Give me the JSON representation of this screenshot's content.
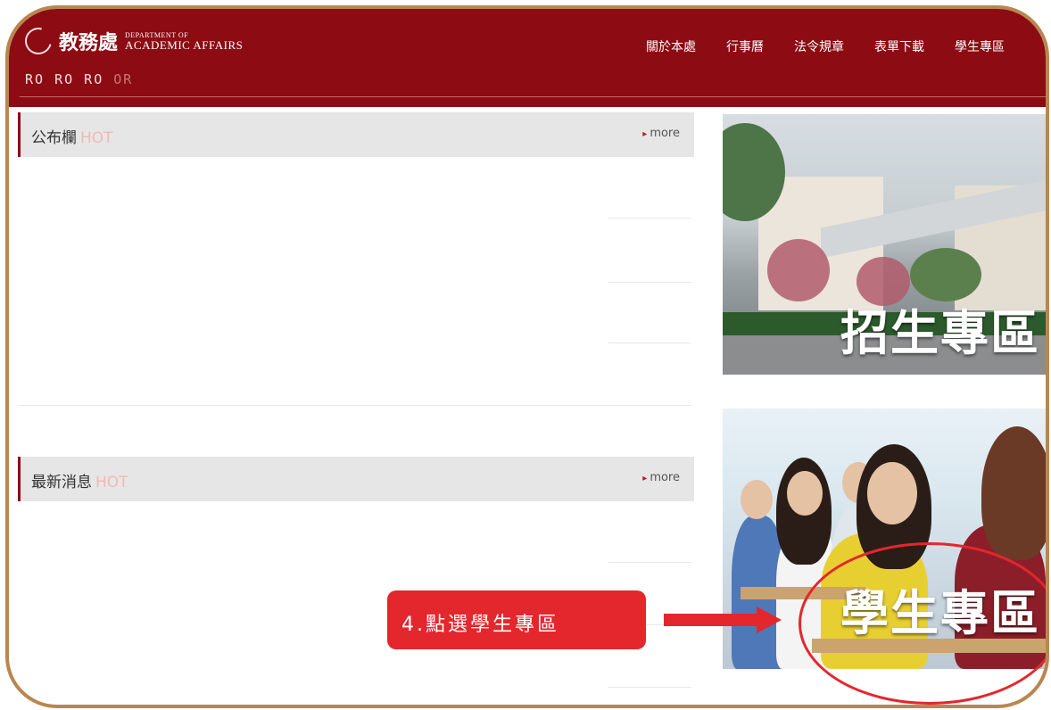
{
  "header": {
    "logo_cn": "教務處",
    "logo_en_top": "DEPARTMENT OF",
    "logo_en_bottom": "ACADEMIC AFFAIRS",
    "logo_script": "RO RO RO",
    "logo_script_faint": "OR"
  },
  "nav": {
    "items": [
      "關於本處",
      "行事曆",
      "法令規章",
      "表單下載",
      "學生專區"
    ]
  },
  "panels": {
    "bulletin": {
      "title": "公布欄",
      "hot": "HOT",
      "more": "more"
    },
    "news": {
      "title": "最新消息",
      "hot": "HOT",
      "more": "more"
    }
  },
  "promos": {
    "admission": "招生專區",
    "student": "學生專區"
  },
  "annotation": {
    "callout": "4.點選學生專區"
  },
  "colors": {
    "header_bg": "#8d0b12",
    "annotation_red": "#e3272d",
    "frame_border": "#b8874f"
  }
}
